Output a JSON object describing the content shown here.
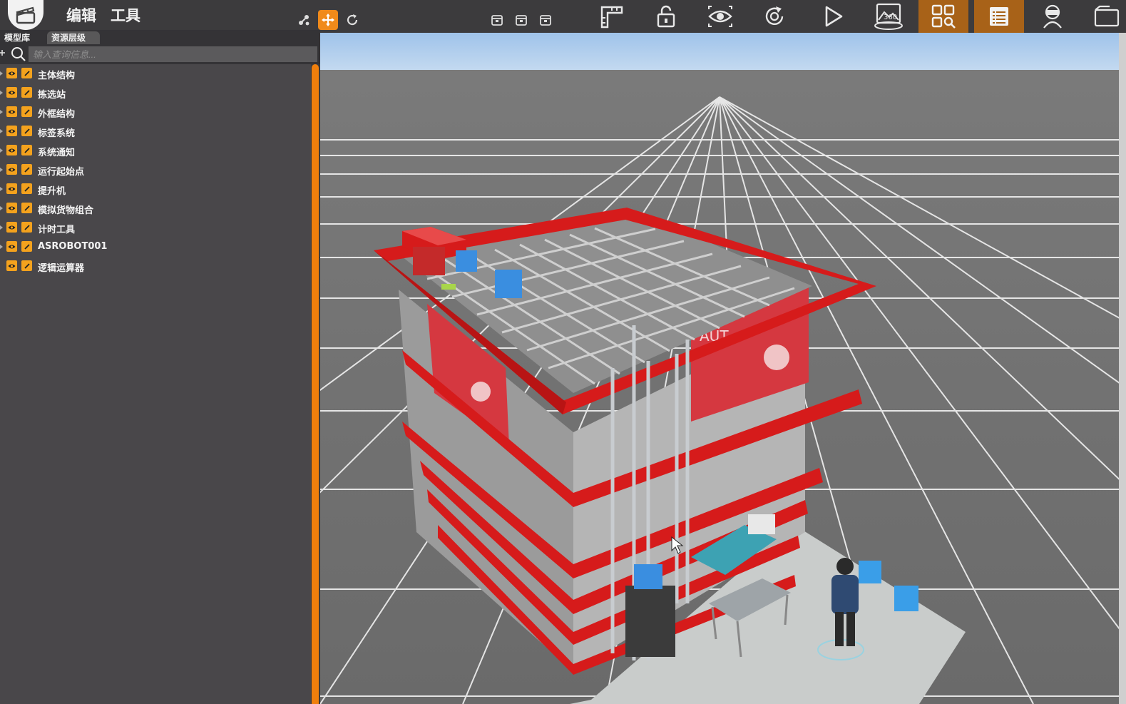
{
  "menu": {
    "edit": "编辑",
    "tools": "工具"
  },
  "toolbar": {
    "mode_icons": [
      "node-tool-icon",
      "move-icon",
      "rotate-icon"
    ],
    "save_icons": [
      "save-icon-1",
      "save-icon-2",
      "save-icon-3"
    ],
    "big_icons": [
      "ruler-icon",
      "unlock-icon",
      "eye-icon",
      "reset-view-icon",
      "play-icon",
      "panorama-360-icon",
      "grid-search-icon",
      "list-icon",
      "vr-headset-icon",
      "scene-icon"
    ],
    "panorama_label": "360"
  },
  "left_panel": {
    "tabs": [
      "模型库",
      "资源层级"
    ],
    "active_tab": "资源层级",
    "search_placeholder": "输入查询信息...",
    "tree": [
      "主体结构",
      "拣选站",
      "外框结构",
      "标签系统",
      "系统通知",
      "运行起始点",
      "提升机",
      "模拟货物组合",
      "计时工具",
      "ASROBOT001",
      "逻辑运算器"
    ]
  },
  "colors": {
    "accent": "#f08a1a",
    "accent_dark": "#a86218",
    "chip": "#f4a21d",
    "panel": "#49474a",
    "frame_red": "#d61b1b"
  },
  "scene": {
    "banner_text": "AUT"
  }
}
